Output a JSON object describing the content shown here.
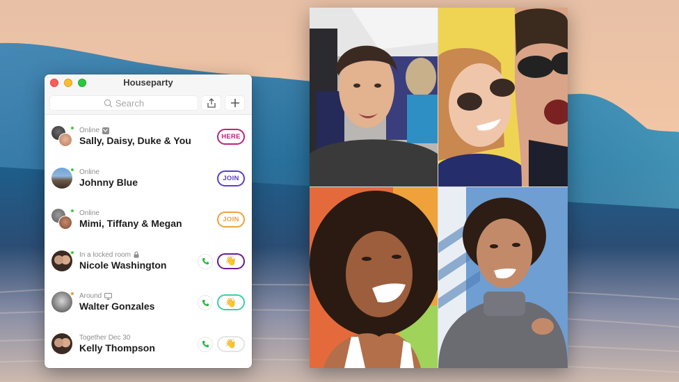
{
  "window": {
    "title": "Houseparty",
    "controls": [
      "close",
      "minimize",
      "maximize"
    ]
  },
  "toolbar": {
    "search_placeholder": "Search",
    "share_icon": "share-icon",
    "add_icon": "plus-icon"
  },
  "contacts": [
    {
      "status": "Online",
      "status_icon": "chevron-down-icon",
      "name": "Sally, Daisy, Duke & You",
      "presence": "online",
      "action": {
        "type": "pill",
        "label": "HERE",
        "color": "#c2207a"
      }
    },
    {
      "status": "Online",
      "name": "Johnny Blue",
      "presence": "online",
      "action": {
        "type": "pill",
        "label": "JOIN",
        "color": "#5b3fc7"
      }
    },
    {
      "status": "Online",
      "name": "Mimi, Tiffany & Megan",
      "presence": "online",
      "action": {
        "type": "pill",
        "label": "JOIN",
        "color": "#eaa23d"
      }
    },
    {
      "status": "In a locked room",
      "status_icon": "lock-icon",
      "name": "Nicole Washington",
      "presence": "online",
      "action": {
        "type": "wave",
        "label": "👋",
        "color": "#6a1b8c"
      }
    },
    {
      "status": "Around",
      "status_icon": "desktop-icon",
      "name": "Walter Gonzales",
      "presence": "away",
      "action": {
        "type": "wave",
        "label": "👋",
        "color": "#3ccfa0"
      }
    },
    {
      "status": "Together Dec 30",
      "name": "Kelly Thompson",
      "presence": "none",
      "action": {
        "type": "wave",
        "label": "👋",
        "color": "#e4e4e4"
      }
    }
  ],
  "colors": {
    "online": "#3fcf3a",
    "away": "#f39a3c",
    "call_green": "#2fb84a"
  },
  "video_tiles": [
    {
      "description": "man-on-airplane"
    },
    {
      "description": "couple-with-sunglasses"
    },
    {
      "description": "woman-laughing-curly-hair"
    },
    {
      "description": "woman-turtleneck-smiling"
    }
  ]
}
